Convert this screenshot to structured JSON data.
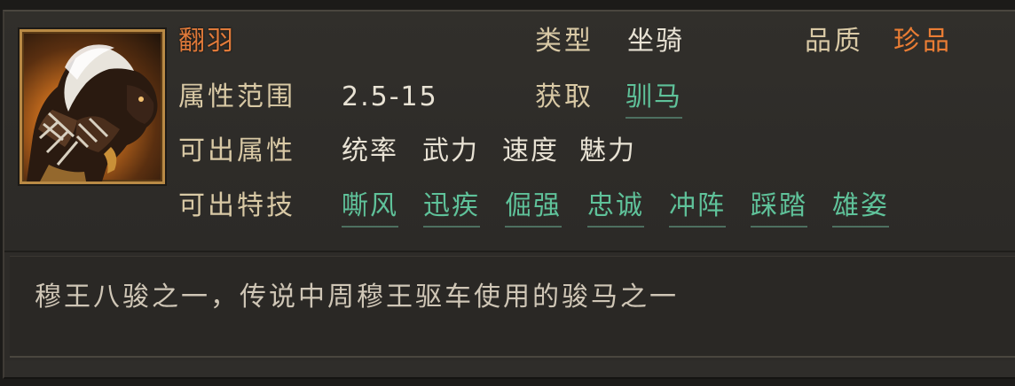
{
  "item": {
    "name": "翻羽",
    "type_label": "类型",
    "type_value": "坐骑",
    "quality_label": "品质",
    "quality_value": "珍品",
    "attr_range_label": "属性范围",
    "attr_range_value": "2.5-15",
    "obtain_label": "获取",
    "obtain_value": "驯马",
    "attributes_label": "可出属性",
    "attributes": [
      "统率",
      "武力",
      "速度",
      "魅力"
    ],
    "skills_label": "可出特技",
    "skills": [
      "嘶风",
      "迅疾",
      "倔强",
      "忠诚",
      "冲阵",
      "踩踏",
      "雄姿"
    ],
    "portrait_icon": "horse-icon"
  },
  "description": "穆王八骏之一，传说中周穆王驱车使用的骏马之一",
  "colors": {
    "name": "#e07a3a",
    "quality": "#ea7d34",
    "link": "#5fc29a",
    "label": "#d9c9a5",
    "panel": "#2d2b28"
  }
}
